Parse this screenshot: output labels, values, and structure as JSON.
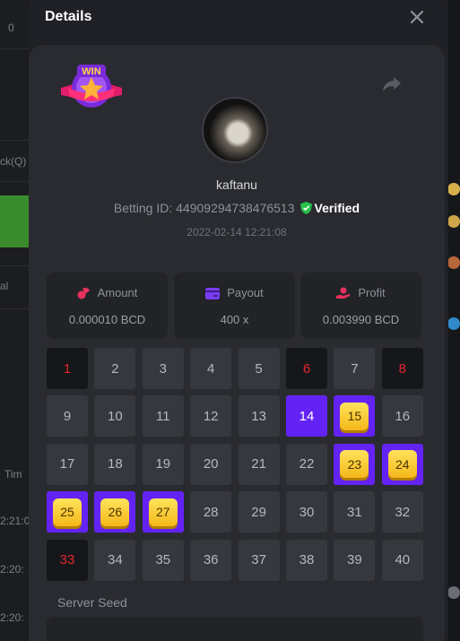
{
  "background": {
    "left_texts": [
      "0",
      "ck(Q)",
      "al",
      "Tim",
      "2:21:0",
      "2:20:",
      "2:20:"
    ]
  },
  "modal": {
    "title": "Details",
    "close_icon": "close-icon",
    "share_icon": "share-icon",
    "win_badge": "WIN"
  },
  "player": {
    "username": "kaftanu",
    "betting_id_label": "Betting ID:",
    "betting_id": "44909294738476513",
    "verified_label": "Verified",
    "timestamp": "2022-02-14 12:21:08"
  },
  "stats": [
    {
      "label": "Amount",
      "value": "0.000010 BCD",
      "icon": "coins-icon",
      "color": "#e8315f"
    },
    {
      "label": "Payout",
      "value": "400 x",
      "icon": "wallet-icon",
      "color": "#7b3cf5"
    },
    {
      "label": "Profit",
      "value": "0.003990 BCD",
      "icon": "hand-coin-icon",
      "color": "#e8315f"
    }
  ],
  "grid": {
    "columns": 8,
    "numbers": [
      "1",
      "2",
      "3",
      "4",
      "5",
      "6",
      "7",
      "8",
      "9",
      "10",
      "11",
      "12",
      "13",
      "14",
      "15",
      "16",
      "17",
      "18",
      "19",
      "20",
      "21",
      "22",
      "23",
      "24",
      "25",
      "26",
      "27",
      "28",
      "29",
      "30",
      "31",
      "32",
      "33",
      "34",
      "35",
      "36",
      "37",
      "38",
      "39",
      "40"
    ],
    "misses": [
      1,
      6,
      8,
      33
    ],
    "picks": [
      14
    ],
    "hits": [
      15,
      23,
      24,
      25,
      26,
      27
    ]
  },
  "seed": {
    "label": "Server Seed"
  },
  "colors": {
    "accent": "#6423f5",
    "miss_text": "#e0272d",
    "verified_green": "#27c24c"
  }
}
